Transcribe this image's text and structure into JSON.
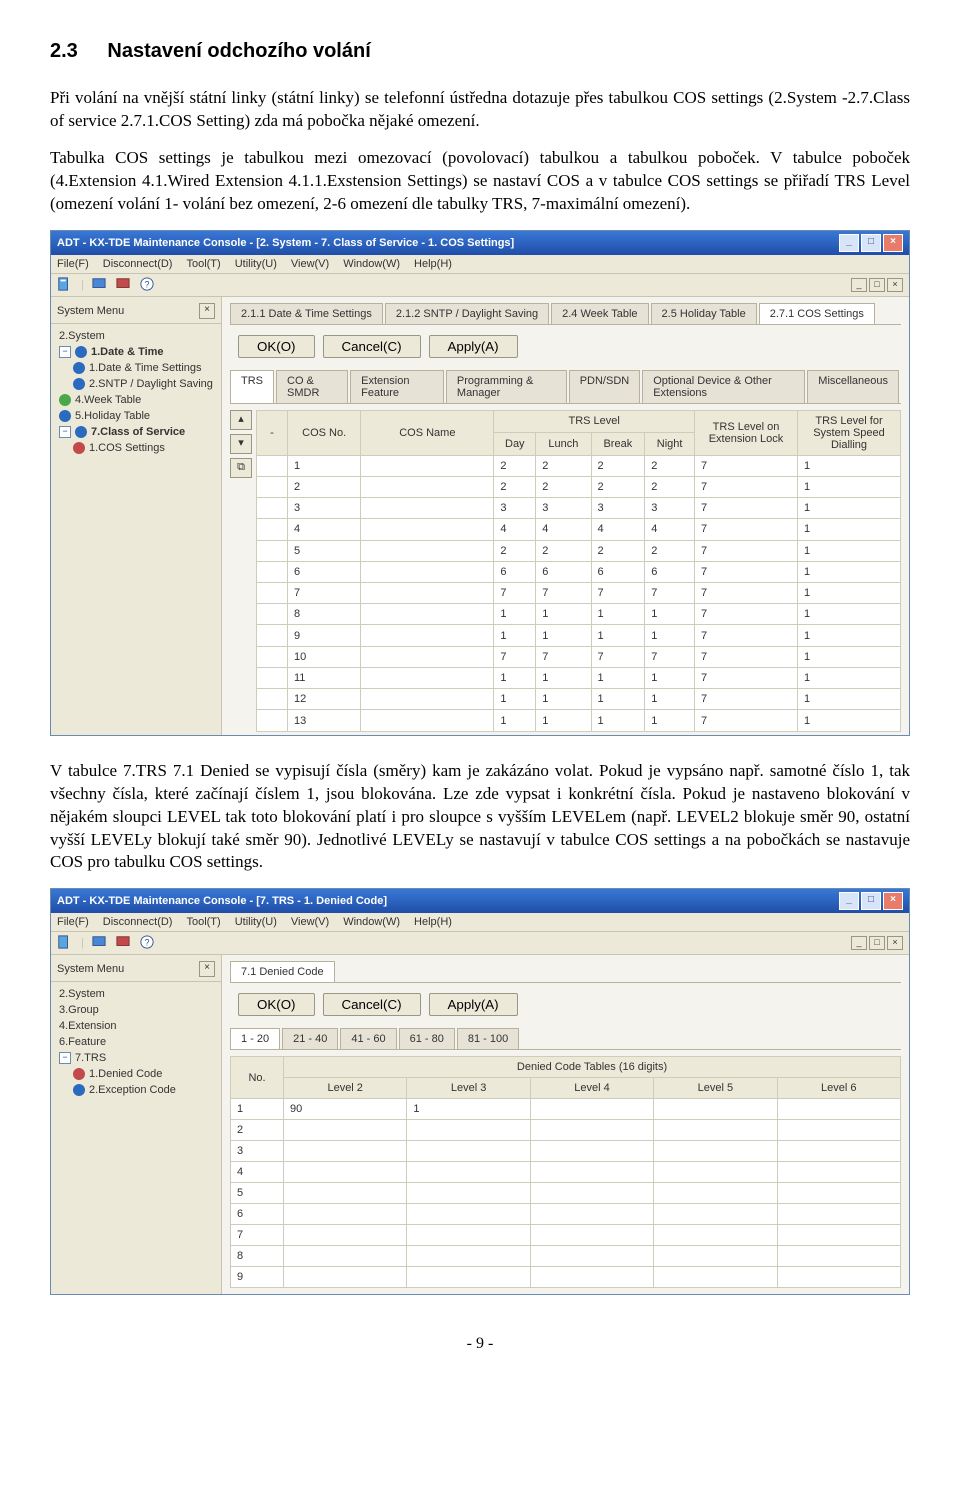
{
  "heading": {
    "num": "2.3",
    "title": "Nastavení odchozího volání"
  },
  "para1": "Při volání na vnější státní linky (státní linky) se telefonní ústředna dotazuje přes tabulkou COS settings (2.System -2.7.Class of service 2.7.1.COS Setting) zda má pobočka nějaké omezení.",
  "para2": "Tabulka COS settings je tabulkou mezi omezovací (povolovací) tabulkou a tabulkou poboček. V tabulce poboček (4.Extension 4.1.Wired Extension 4.1.1.Exstension Settings) se nastaví COS a v tabulce COS settings se přiřadí TRS Level (omezení volání 1- volání bez omezení, 2-6 omezení dle tabulky TRS, 7-maximální omezení).",
  "para3": "V tabulce 7.TRS 7.1 Denied se vypisují čísla (směry) kam je zakázáno volat. Pokud je vypsáno např. samotné číslo 1, tak všechny čísla, které začínají číslem 1, jsou blokována. Lze zde vypsat i konkrétní čísla. Pokud je nastaveno blokování v nějakém sloupci LEVEL tak toto blokování platí i pro sloupce s vyšším LEVELem (např. LEVEL2 blokuje směr 90, ostatní vyšší LEVELy blokují také směr 90). Jednotlivé LEVELy se nastavují v tabulce COS settings a na pobočkách se nastavuje COS pro tabulku COS settings.",
  "win1": {
    "title": "ADT - KX-TDE Maintenance Console - [2. System - 7. Class of Service - 1. COS Settings]",
    "menu": [
      "File(F)",
      "Disconnect(D)",
      "Tool(T)",
      "Utility(U)",
      "View(V)",
      "Window(W)",
      "Help(H)"
    ],
    "sysmenu": "System Menu",
    "tree": {
      "root": "2.System",
      "items": [
        {
          "label": "1.Date & Time",
          "expand": "-"
        },
        {
          "label": "1.Date & Time Settings",
          "indent": true,
          "bold": false,
          "color": "b"
        },
        {
          "label": "2.SNTP / Daylight Saving",
          "indent": true,
          "color": "b"
        },
        {
          "label": "4.Week Table",
          "color": "b"
        },
        {
          "label": "5.Holiday Table",
          "color": "b"
        },
        {
          "label": "7.Class of Service",
          "expand": "-",
          "color": "b"
        },
        {
          "label": "1.COS Settings",
          "indent": true,
          "color": "r"
        }
      ]
    },
    "toptabs": [
      "2.1.1 Date & Time Settings",
      "2.1.2 SNTP / Daylight Saving",
      "2.4 Week Table",
      "2.5 Holiday Table",
      "2.7.1 COS Settings"
    ],
    "actions": {
      "ok": "OK(O)",
      "cancel": "Cancel(C)",
      "apply": "Apply(A)"
    },
    "subtabs": [
      "TRS",
      "CO & SMDR",
      "Extension Feature",
      "Programming & Manager",
      "PDN/SDN",
      "Optional Device & Other Extensions",
      "Miscellaneous"
    ],
    "cols": {
      "dash": "-",
      "cosno": "COS No.",
      "cosname": "COS Name",
      "trslevel": "TRS Level",
      "day": "Day",
      "lunch": "Lunch",
      "break": "Break",
      "night": "Night",
      "lock": "TRS Level on Extension Lock",
      "speed": "TRS Level for System Speed Dialling"
    },
    "rows": [
      {
        "no": "1",
        "name": "",
        "day": "2",
        "lunch": "2",
        "break": "2",
        "night": "2",
        "lock": "7",
        "speed": "1"
      },
      {
        "no": "2",
        "name": "",
        "day": "2",
        "lunch": "2",
        "break": "2",
        "night": "2",
        "lock": "7",
        "speed": "1"
      },
      {
        "no": "3",
        "name": "",
        "day": "3",
        "lunch": "3",
        "break": "3",
        "night": "3",
        "lock": "7",
        "speed": "1"
      },
      {
        "no": "4",
        "name": "",
        "day": "4",
        "lunch": "4",
        "break": "4",
        "night": "4",
        "lock": "7",
        "speed": "1"
      },
      {
        "no": "5",
        "name": "",
        "day": "2",
        "lunch": "2",
        "break": "2",
        "night": "2",
        "lock": "7",
        "speed": "1"
      },
      {
        "no": "6",
        "name": "",
        "day": "6",
        "lunch": "6",
        "break": "6",
        "night": "6",
        "lock": "7",
        "speed": "1"
      },
      {
        "no": "7",
        "name": "",
        "day": "7",
        "lunch": "7",
        "break": "7",
        "night": "7",
        "lock": "7",
        "speed": "1"
      },
      {
        "no": "8",
        "name": "",
        "day": "1",
        "lunch": "1",
        "break": "1",
        "night": "1",
        "lock": "7",
        "speed": "1"
      },
      {
        "no": "9",
        "name": "",
        "day": "1",
        "lunch": "1",
        "break": "1",
        "night": "1",
        "lock": "7",
        "speed": "1"
      },
      {
        "no": "10",
        "name": "",
        "day": "7",
        "lunch": "7",
        "break": "7",
        "night": "7",
        "lock": "7",
        "speed": "1"
      },
      {
        "no": "11",
        "name": "",
        "day": "1",
        "lunch": "1",
        "break": "1",
        "night": "1",
        "lock": "7",
        "speed": "1"
      },
      {
        "no": "12",
        "name": "",
        "day": "1",
        "lunch": "1",
        "break": "1",
        "night": "1",
        "lock": "7",
        "speed": "1"
      },
      {
        "no": "13",
        "name": "",
        "day": "1",
        "lunch": "1",
        "break": "1",
        "night": "1",
        "lock": "7",
        "speed": "1"
      }
    ]
  },
  "win2": {
    "title": "ADT - KX-TDE Maintenance Console - [7. TRS - 1. Denied Code]",
    "menu": [
      "File(F)",
      "Disconnect(D)",
      "Tool(T)",
      "Utility(U)",
      "View(V)",
      "Window(W)",
      "Help(H)"
    ],
    "sysmenu": "System Menu",
    "tree": [
      "2.System",
      "3.Group",
      "4.Extension",
      "6.Feature",
      "7.TRS",
      "1.Denied Code",
      "2.Exception Code"
    ],
    "toptab": "7.1 Denied Code",
    "actions": {
      "ok": "OK(O)",
      "cancel": "Cancel(C)",
      "apply": "Apply(A)"
    },
    "rangetabs": [
      "1 - 20",
      "21 - 40",
      "41 - 60",
      "61 - 80",
      "81 - 100"
    ],
    "caption": "Denied Code Tables (16 digits)",
    "cols": {
      "no": "No.",
      "l2": "Level 2",
      "l3": "Level 3",
      "l4": "Level 4",
      "l5": "Level 5",
      "l6": "Level 6"
    },
    "rows": [
      {
        "no": "1",
        "l2": "90",
        "l3": "1",
        "l4": "",
        "l5": "",
        "l6": ""
      },
      {
        "no": "2",
        "l2": "",
        "l3": "",
        "l4": "",
        "l5": "",
        "l6": ""
      },
      {
        "no": "3",
        "l2": "",
        "l3": "",
        "l4": "",
        "l5": "",
        "l6": ""
      },
      {
        "no": "4",
        "l2": "",
        "l3": "",
        "l4": "",
        "l5": "",
        "l6": ""
      },
      {
        "no": "5",
        "l2": "",
        "l3": "",
        "l4": "",
        "l5": "",
        "l6": ""
      },
      {
        "no": "6",
        "l2": "",
        "l3": "",
        "l4": "",
        "l5": "",
        "l6": ""
      },
      {
        "no": "7",
        "l2": "",
        "l3": "",
        "l4": "",
        "l5": "",
        "l6": ""
      },
      {
        "no": "8",
        "l2": "",
        "l3": "",
        "l4": "",
        "l5": "",
        "l6": ""
      },
      {
        "no": "9",
        "l2": "",
        "l3": "",
        "l4": "",
        "l5": "",
        "l6": ""
      }
    ]
  },
  "pagefoot": "- 9 -",
  "glyph": {
    "min": "_",
    "max": "□",
    "close": "×",
    "arrowdn": "▾",
    "arrowup": "▴",
    "copy": "⧉"
  }
}
